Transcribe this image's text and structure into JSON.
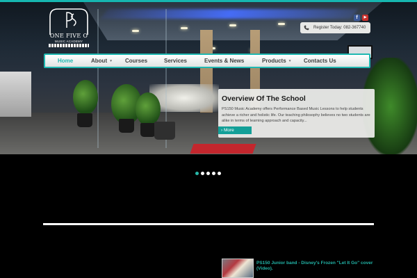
{
  "logo": {
    "name": "ONE FIVE O",
    "tagline": "MUSIC ACADEMY"
  },
  "social": {
    "facebook_icon": "facebook-icon",
    "facebook_glyph": "f",
    "youtube_icon": "youtube-icon",
    "youtube_glyph": "▶"
  },
  "register": {
    "label": "Register Today: 082-367740",
    "icon": "phone-icon"
  },
  "nav": {
    "items": [
      {
        "label": "Home",
        "active": true
      },
      {
        "label": "About",
        "dropdown": true
      },
      {
        "label": "Courses"
      },
      {
        "label": "Services"
      },
      {
        "label": "Events & News"
      },
      {
        "label": "Products",
        "dropdown": true
      },
      {
        "label": "Contacts Us"
      }
    ],
    "dropdown_glyph": "▼"
  },
  "overview": {
    "title": "Overview Of The School",
    "body": "PS150 Music Academy offers Performance Based Music Lessons to help students achieve a richer and holistic life. Our teaching philosophy believes no two students are alike in terms of learning approach and capacity...",
    "more_label": "› More"
  },
  "slider": {
    "total": 5,
    "active_index": 0
  },
  "video": {
    "title": "PS150 Junior band - Disney's Frozen \"Let It Go\" cover (Video)."
  },
  "colors": {
    "accent": "#1fb8b1",
    "background": "#000000",
    "nav_text": "#3d3d3d"
  }
}
